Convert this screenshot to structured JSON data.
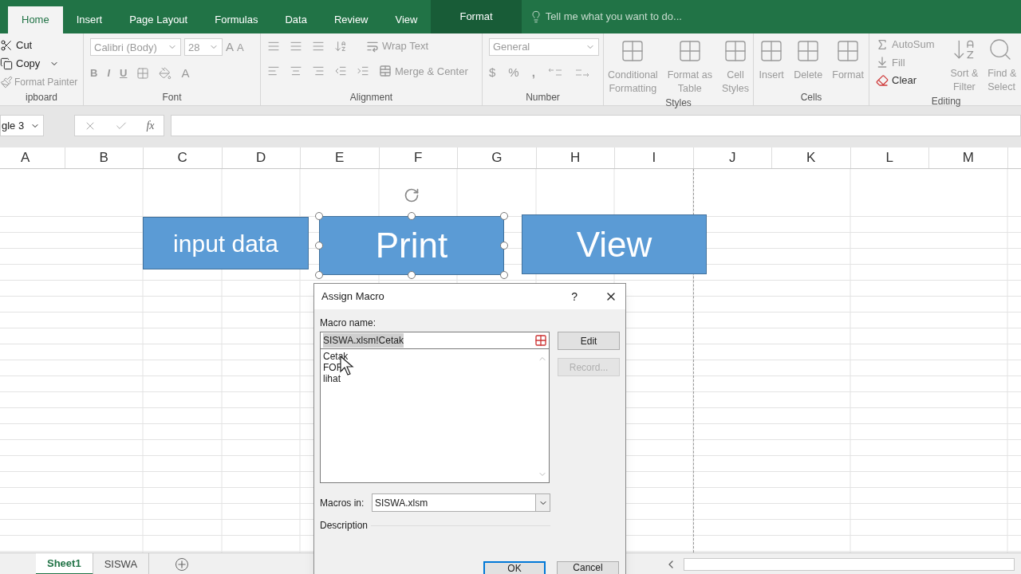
{
  "ribbon_tabs": [
    {
      "label": "Home",
      "selected": true,
      "kind": "tab"
    },
    {
      "label": "Insert",
      "selected": false,
      "kind": "tab"
    },
    {
      "label": "Page Layout",
      "selected": false,
      "kind": "tab"
    },
    {
      "label": "Formulas",
      "selected": false,
      "kind": "tab"
    },
    {
      "label": "Data",
      "selected": false,
      "kind": "tab"
    },
    {
      "label": "Review",
      "selected": false,
      "kind": "tab"
    },
    {
      "label": "View",
      "selected": false,
      "kind": "tab"
    },
    {
      "label": "Format",
      "selected": false,
      "kind": "contextual"
    }
  ],
  "tell_me": {
    "placeholder": "Tell me what you want to do..."
  },
  "clipboard": {
    "label": "ipboard",
    "cut": "Cut",
    "copy": "Copy",
    "format_painter": "Format Painter"
  },
  "font": {
    "label": "Font",
    "font_name": "Calibri (Body)",
    "font_size": "28",
    "grow": "A",
    "shrink": "A",
    "bold": "B",
    "italic": "I",
    "underline": "U",
    "font_color": "A"
  },
  "alignment": {
    "label": "Alignment",
    "wrap_text": "Wrap Text",
    "merge_center": "Merge & Center"
  },
  "number": {
    "label": "Number",
    "format": "General",
    "currency": "$",
    "percent": "%",
    "comma": ","
  },
  "styles": {
    "label": "Styles",
    "items": [
      [
        "Conditional",
        "Formatting"
      ],
      [
        "Format as",
        "Table"
      ],
      [
        "Cell",
        "Styles"
      ]
    ]
  },
  "cells": {
    "label": "Cells",
    "items": [
      "Insert",
      "Delete",
      "Format"
    ]
  },
  "editing": {
    "label": "Editing",
    "autosum": "AutoSum",
    "fill": "Fill",
    "clear": "Clear",
    "sort": [
      "Sort &",
      "Filter"
    ],
    "find": [
      "Find &",
      "Select"
    ]
  },
  "formula_bar": {
    "name_box": "gle 3",
    "function_label": "fx"
  },
  "columns": [
    "A",
    "B",
    "C",
    "D",
    "E",
    "F",
    "G",
    "H",
    "I",
    "J",
    "K",
    "L",
    "M"
  ],
  "shapes": [
    {
      "text": "input data",
      "selected": false
    },
    {
      "text": "Print",
      "selected": true
    },
    {
      "text": "View",
      "selected": false
    }
  ],
  "dialog": {
    "title": "Assign Macro",
    "help": "?",
    "macro_name_label": "Macro name:",
    "macro_name": "SISWA.xlsm!Cetak",
    "macros": [
      "Cetak",
      "FOR",
      "lihat"
    ],
    "buttons": [
      {
        "label": "Edit",
        "disabled": false
      },
      {
        "label": "Record...",
        "disabled": true
      }
    ],
    "macros_in_label": "Macros in:",
    "macros_in": "SISWA.xlsm",
    "description_label": "Description",
    "footer_buttons": [
      {
        "label": "OK",
        "selected": true
      },
      {
        "label": "Cancel",
        "selected": false
      }
    ]
  },
  "sheet_tabs": [
    {
      "label": "Sheet1",
      "selected": true
    },
    {
      "label": "SISWA",
      "selected": false
    }
  ]
}
